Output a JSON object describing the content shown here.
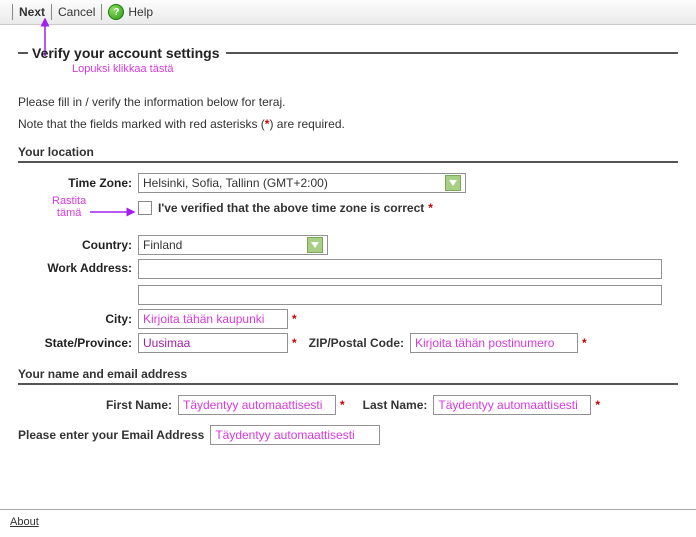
{
  "toolbar": {
    "next": "Next",
    "cancel": "Cancel",
    "help": "Help"
  },
  "section": {
    "title": "Verify your account settings",
    "annotation_top": "Lopuksi klikkaa tästä",
    "intro1": "Please fill in / verify the information below for teraj.",
    "intro2_pre": "Note that the fields marked with red asterisks (",
    "intro2_mark": "*",
    "intro2_post": ") are required."
  },
  "location": {
    "heading": "Your location",
    "timezone_label": "Time Zone:",
    "timezone_value": "Helsinki, Sofia, Tallinn (GMT+2:00)",
    "verify_anno1": "Rastita",
    "verify_anno2": "tämä",
    "verify_label": "I've verified that the above time zone is correct",
    "country_label": "Country:",
    "country_value": "Finland",
    "work_label": "Work Address:",
    "work_value": "",
    "city_label": "City:",
    "city_placeholder": "Kirjoita tähän kaupunki",
    "state_label": "State/Province:",
    "state_value": "Uusimaa",
    "zip_label": "ZIP/Postal Code:",
    "zip_placeholder": "Kirjoita tähän postinumero"
  },
  "nameemail": {
    "heading": "Your name and email address",
    "first_label": "First Name:",
    "first_ph": "Täydentyy automaattisesti",
    "last_label": "Last Name:",
    "last_ph": "Täydentyy automaattisesti",
    "email_label": "Please enter your Email Address",
    "email_ph": "Täydentyy automaattisesti"
  },
  "footer": {
    "about": "About"
  }
}
